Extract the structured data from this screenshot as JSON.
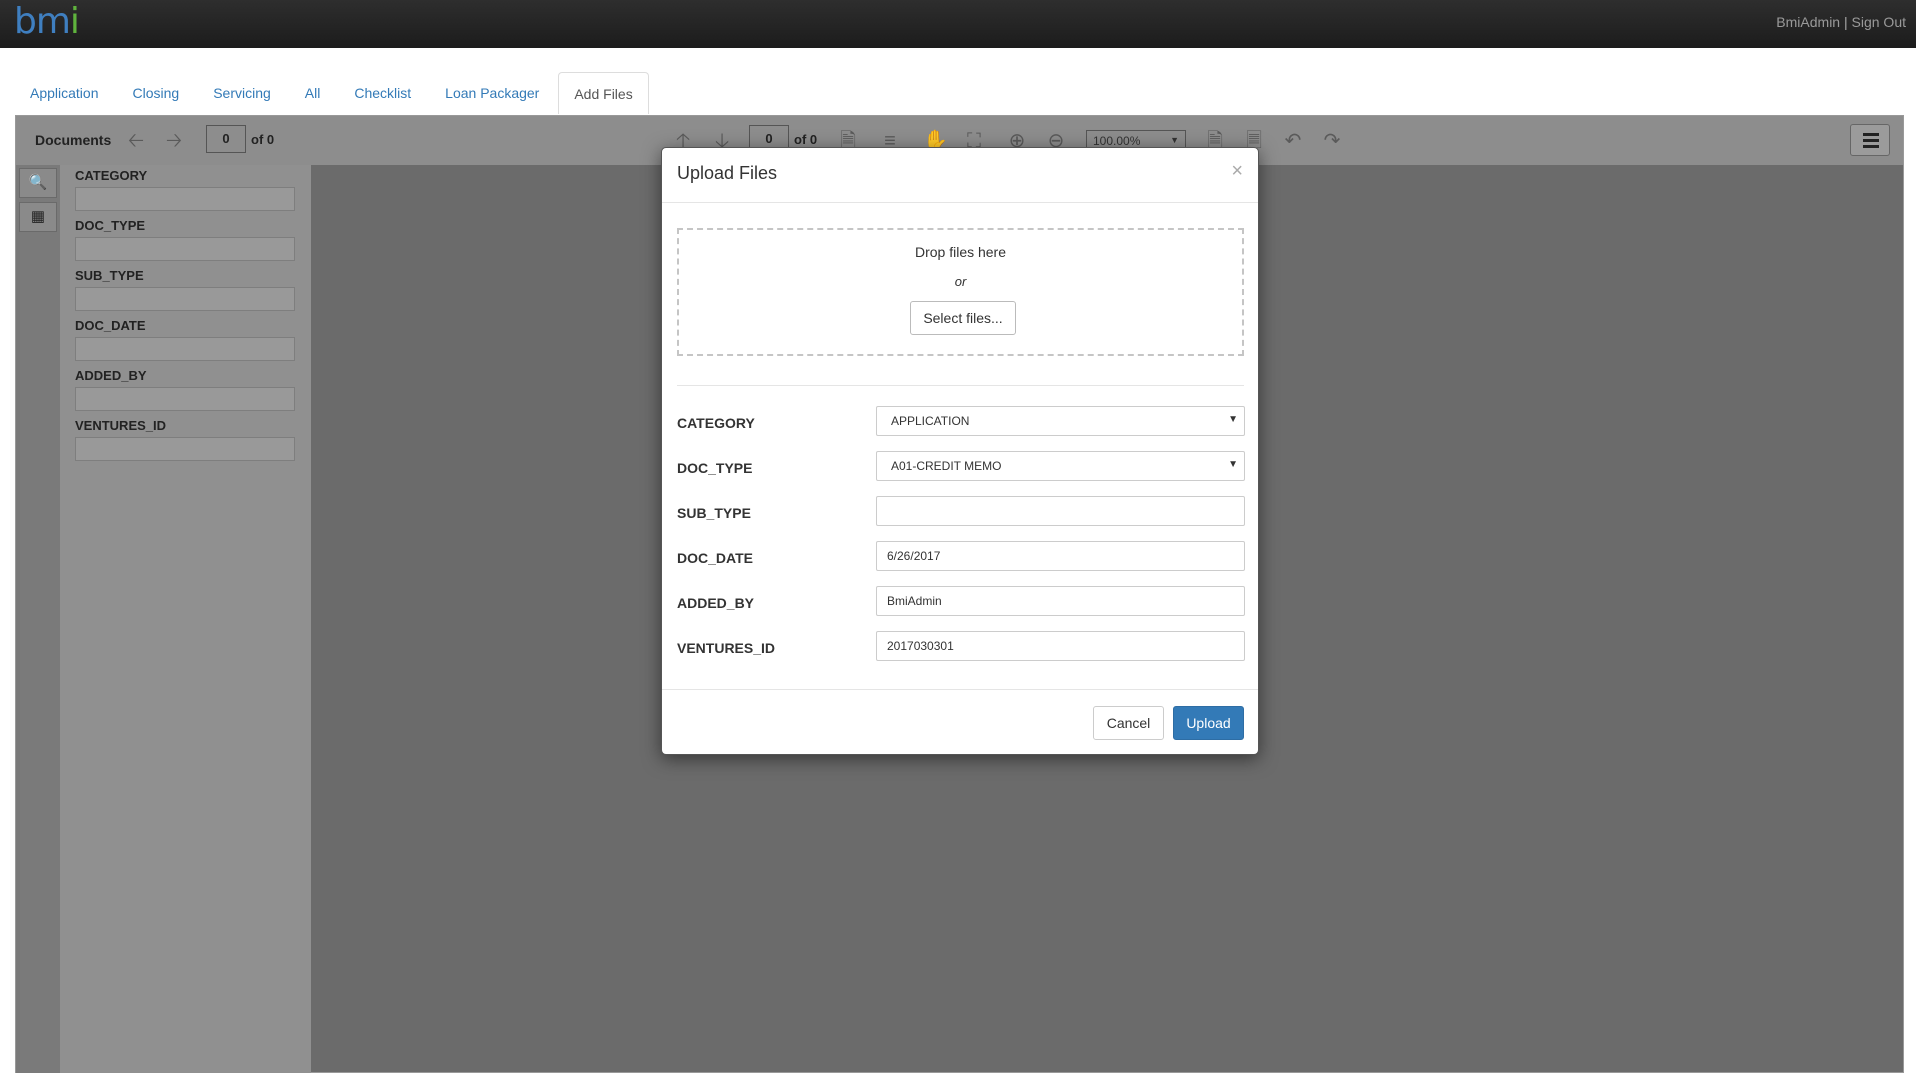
{
  "app": {
    "logo_b": "bm",
    "logo_i": "i",
    "user": "BmiAdmin",
    "separator": "|",
    "signout": "Sign Out"
  },
  "tabs": [
    {
      "label": "Application"
    },
    {
      "label": "Closing"
    },
    {
      "label": "Servicing"
    },
    {
      "label": "All"
    },
    {
      "label": "Checklist"
    },
    {
      "label": "Loan Packager"
    },
    {
      "label": "Add Files",
      "active": true
    }
  ],
  "viewer": {
    "documents_label": "Documents",
    "doc_page": "0",
    "doc_of": "of 0",
    "page": "0",
    "page_of": "of 0",
    "zoom": "100.00%"
  },
  "filters": [
    {
      "label": "CATEGORY"
    },
    {
      "label": "DOC_TYPE"
    },
    {
      "label": "SUB_TYPE"
    },
    {
      "label": "DOC_DATE"
    },
    {
      "label": "ADDED_BY"
    },
    {
      "label": "VENTURES_ID"
    }
  ],
  "modal": {
    "title": "Upload Files",
    "close": "×",
    "drop_text": "Drop files here",
    "or": "or",
    "select_files": "Select files...",
    "fields": {
      "category": {
        "label": "CATEGORY",
        "value": "APPLICATION"
      },
      "doc_type": {
        "label": "DOC_TYPE",
        "value": "A01-CREDIT MEMO"
      },
      "sub_type": {
        "label": "SUB_TYPE",
        "value": ""
      },
      "doc_date": {
        "label": "DOC_DATE",
        "value": "6/26/2017"
      },
      "added_by": {
        "label": "ADDED_BY",
        "value": "BmiAdmin"
      },
      "ventures_id": {
        "label": "VENTURES_ID",
        "value": "2017030301"
      }
    },
    "cancel": "Cancel",
    "upload": "Upload"
  }
}
